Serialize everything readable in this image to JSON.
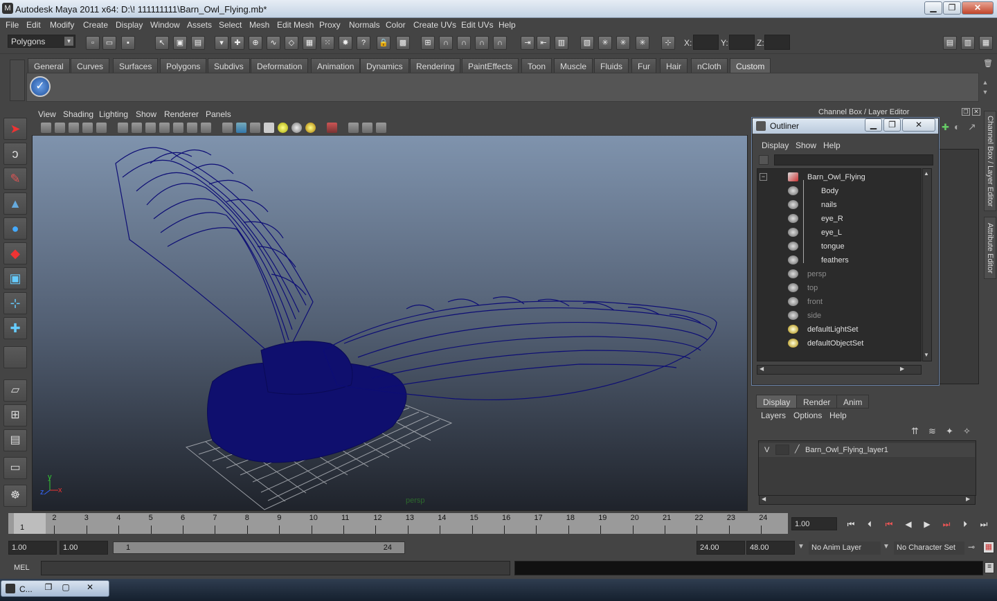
{
  "window": {
    "title": "Autodesk Maya 2011 x64: D:\\! 111111111\\Barn_Owl_Flying.mb*",
    "minimize": "▁",
    "maximize": "❐",
    "close": "✕"
  },
  "menubar": [
    "File",
    "Edit",
    "Modify",
    "Create",
    "Display",
    "Window",
    "Assets",
    "Select",
    "Mesh",
    "Edit Mesh",
    "Proxy",
    "Normals",
    "Color",
    "Create UVs",
    "Edit UVs",
    "Help"
  ],
  "toolbar": {
    "mode": "Polygons",
    "x_label": "X:",
    "y_label": "Y:",
    "z_label": "Z:"
  },
  "shelf_tabs": [
    "General",
    "Curves",
    "Surfaces",
    "Polygons",
    "Subdivs",
    "Deformation",
    "Animation",
    "Dynamics",
    "Rendering",
    "PaintEffects",
    "Toon",
    "Muscle",
    "Fluids",
    "Fur",
    "Hair",
    "nCloth",
    "Custom"
  ],
  "shelf_active": "Custom",
  "viewport": {
    "menu": [
      "View",
      "Shading",
      "Lighting",
      "Show",
      "Renderer",
      "Panels"
    ],
    "camera": "persp",
    "axis_y": "y",
    "axis_x": "x",
    "axis_z": "z"
  },
  "channel_box_title": "Channel Box / Layer Editor",
  "outliner": {
    "title": "Outliner",
    "menu": [
      "Display",
      "Show",
      "Help"
    ],
    "items": [
      {
        "label": "Barn_Owl_Flying",
        "icon": "group-icon",
        "dim": false
      },
      {
        "label": "Body",
        "icon": "mesh-icon",
        "dim": false
      },
      {
        "label": "nails",
        "icon": "mesh-icon",
        "dim": false
      },
      {
        "label": "eye_R",
        "icon": "mesh-icon",
        "dim": false
      },
      {
        "label": "eye_L",
        "icon": "mesh-icon",
        "dim": false
      },
      {
        "label": "tongue",
        "icon": "mesh-icon",
        "dim": false
      },
      {
        "label": "feathers",
        "icon": "mesh-icon",
        "dim": false
      },
      {
        "label": "persp",
        "icon": "camera-icon",
        "dim": true
      },
      {
        "label": "top",
        "icon": "camera-icon",
        "dim": true
      },
      {
        "label": "front",
        "icon": "camera-icon",
        "dim": true
      },
      {
        "label": "side",
        "icon": "camera-icon",
        "dim": true
      },
      {
        "label": "defaultLightSet",
        "icon": "set-icon",
        "dim": false
      },
      {
        "label": "defaultObjectSet",
        "icon": "set-icon",
        "dim": false
      }
    ]
  },
  "layer_editor": {
    "tabs": [
      "Display",
      "Render",
      "Anim"
    ],
    "menu": [
      "Layers",
      "Options",
      "Help"
    ],
    "layer": {
      "visible": "V",
      "name": "Barn_Owl_Flying_layer1"
    }
  },
  "side_tabs": [
    "Channel Box / Layer Editor",
    "Attribute Editor"
  ],
  "timeline": {
    "ticks": [
      "1",
      "2",
      "3",
      "4",
      "5",
      "6",
      "7",
      "8",
      "9",
      "10",
      "11",
      "12",
      "13",
      "14",
      "15",
      "16",
      "17",
      "18",
      "19",
      "20",
      "21",
      "22",
      "23",
      "24"
    ],
    "current_frame_marker": "1",
    "current_frame": "1.00"
  },
  "range": {
    "start": "1.00",
    "playback_start": "1.00",
    "slider_in": "1",
    "slider_out": "24",
    "playback_end": "24.00",
    "end": "48.00",
    "anim_layer": "No Anim Layer",
    "character_set": "No Character Set"
  },
  "command_line": {
    "label": "MEL"
  },
  "taskbar": {
    "app": "C..."
  }
}
